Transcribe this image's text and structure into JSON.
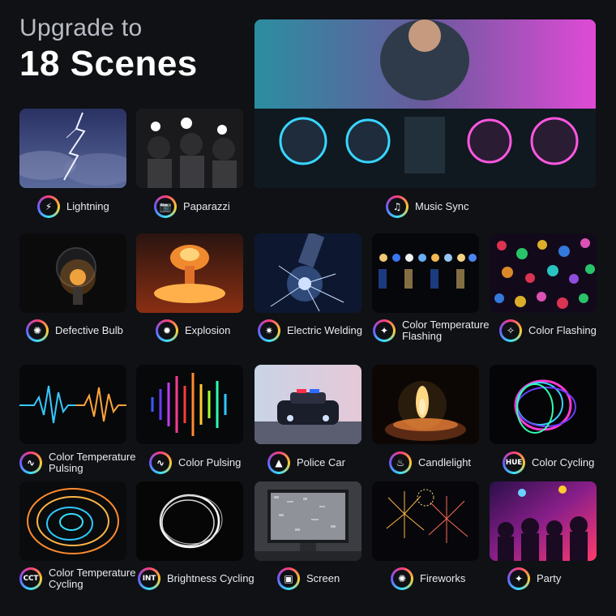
{
  "heading": {
    "pre": "Upgrade to",
    "main": "18 Scenes"
  },
  "scenes": {
    "lightning": {
      "label": "Lightning",
      "icon": "lightning-bolt-icon",
      "glyph": "⚡"
    },
    "paparazzi": {
      "label": "Paparazzi",
      "icon": "camera-icon",
      "glyph": "📷"
    },
    "music_sync": {
      "label": "Music Sync",
      "icon": "music-note-icon",
      "glyph": "♫"
    },
    "defective_bulb": {
      "label": "Defective Bulb",
      "icon": "light-bulb-icon",
      "glyph": "✺"
    },
    "explosion": {
      "label": "Explosion",
      "icon": "bomb-icon",
      "glyph": "✹"
    },
    "electric_welding": {
      "label": "Electric Welding",
      "icon": "welding-spark-icon",
      "glyph": "✷"
    },
    "color_temperature_flashing": {
      "label": [
        "Color Temperature",
        "Flashing"
      ],
      "icon": "flash-burst-icon",
      "glyph": "✦"
    },
    "color_flashing": {
      "label": "Color Flashing",
      "icon": "sparkle-icon",
      "glyph": "✧"
    },
    "color_temperature_pulsing": {
      "label": [
        "Color Temperature",
        "Pulsing"
      ],
      "icon": "waveform-icon",
      "glyph": "∿"
    },
    "color_pulsing": {
      "label": "Color Pulsing",
      "icon": "pulse-wave-icon",
      "glyph": "∿"
    },
    "police_car": {
      "label": "Police Car",
      "icon": "siren-icon",
      "glyph": "▲"
    },
    "candlelight": {
      "label": "Candlelight",
      "icon": "flame-icon",
      "glyph": "♨"
    },
    "color_cycling": {
      "label": "Color Cycling",
      "icon": "hue-badge-icon",
      "glyph": "HUE"
    },
    "color_temperature_cycling": {
      "label": [
        "Color Temperature",
        "Cycling"
      ],
      "icon": "cct-badge-icon",
      "glyph": "CCT"
    },
    "brightness_cycling": {
      "label": "Brightness Cycling",
      "icon": "int-badge-icon",
      "glyph": "INT"
    },
    "screen": {
      "label": "Screen",
      "icon": "tv-screen-icon",
      "glyph": "▣"
    },
    "fireworks": {
      "label": "Fireworks",
      "icon": "firework-icon",
      "glyph": "✺"
    },
    "party": {
      "label": "Party",
      "icon": "party-popper-icon",
      "glyph": "✦"
    }
  }
}
